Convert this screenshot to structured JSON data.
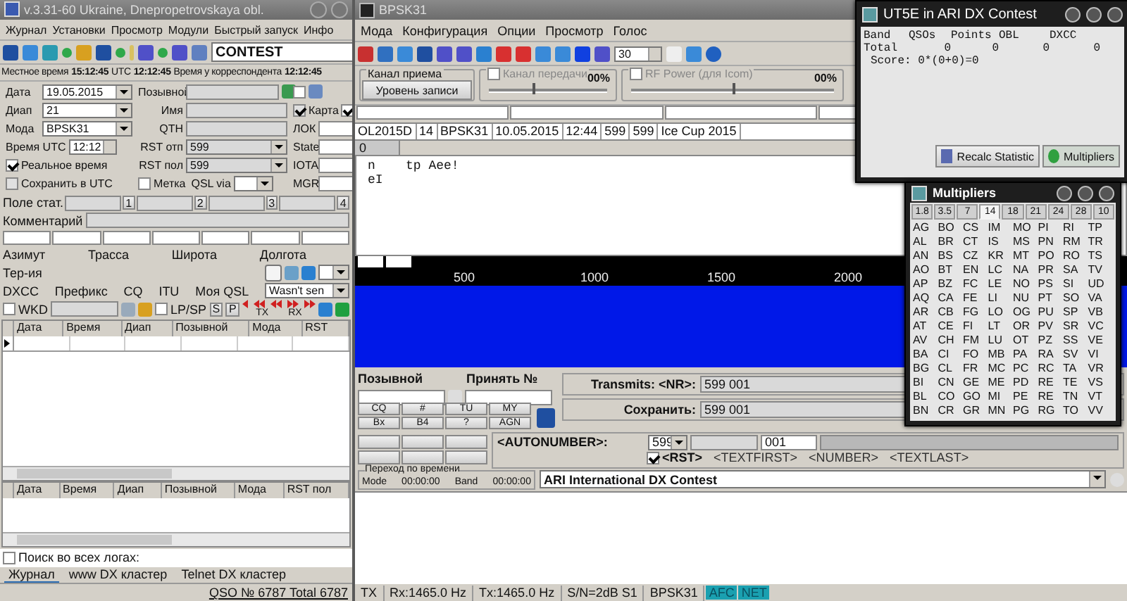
{
  "left": {
    "title": "v.3.31-60 Ukraine, Dnepropetrovskaya obl.",
    "menu": [
      "Журнал",
      "Установки",
      "Просмотр",
      "Модули",
      "Быстрый запуск",
      "Инфо"
    ],
    "mode_select": "CONTEST",
    "clock": [
      {
        "label": "Местное время",
        "value": "15:12:45"
      },
      {
        "label": "UTC",
        "value": "12:12:45"
      },
      {
        "label": "Время у корреспондента",
        "value": "12:12:45"
      }
    ],
    "date": {
      "label": "Дата",
      "value": "19.05.2015"
    },
    "band": {
      "label": "Диап",
      "value": "21"
    },
    "mode": {
      "label": "Мода",
      "value": "BPSK31"
    },
    "utc_time": {
      "label": "Время UTC",
      "value": "12:12"
    },
    "realtime": {
      "label": "Реальное время",
      "checked": true
    },
    "save_utc": {
      "label": "Сохранить в UTC",
      "checked": false
    },
    "callsign_label": "Позывной",
    "name_label": "Имя",
    "qth_label": "QTH",
    "rst_sent": {
      "label": "RST отп",
      "value": "599"
    },
    "rst_rcvd": {
      "label": "RST пол",
      "value": "599"
    },
    "mark": {
      "label": "Метка",
      "checked": false
    },
    "qsl_via_label": "QSL via",
    "map": {
      "label": "Карта",
      "checked": true
    },
    "side_checks": [
      {
        "checked": false
      },
      {
        "checked": true
      }
    ],
    "side_fields": [
      "ЛОК",
      "State",
      "IOTA",
      "MGR"
    ],
    "stat_label": "Поле стат.",
    "stat_buttons": [
      "1",
      "2",
      "3",
      "4"
    ],
    "comment_label": "Комментарий",
    "info_row1": [
      "Азимут",
      "Трасса",
      "Широта",
      "Долгота"
    ],
    "territory_label": "Тер-ия",
    "info_row3": [
      "DXCC",
      "Префикс",
      "CQ",
      "ITU",
      "Моя QSL"
    ],
    "my_qsl": "Wasn't sen",
    "wkd": {
      "label": "WKD",
      "checked": false
    },
    "lpsp": {
      "label": "LP/SP",
      "checked": false
    },
    "sp_buttons": [
      "S",
      "P"
    ],
    "txrx": [
      "TX",
      "RX"
    ],
    "log_columns": [
      "Дата",
      "Время",
      "Диап",
      "Позывной",
      "Мода",
      "RST"
    ],
    "dup_columns": [
      "Дата",
      "Время",
      "Диап",
      "Позывной",
      "Мода",
      "RST пол"
    ],
    "search_all": {
      "label": "Поиск во всех логах:",
      "checked": false
    },
    "tabs": [
      {
        "label": "Журнал",
        "selected": true
      },
      {
        "label": "www DX кластер",
        "selected": false
      },
      {
        "label": "Telnet DX кластер",
        "selected": false
      }
    ],
    "status": "QSO № 6787 Total 6787"
  },
  "main": {
    "title": "BPSK31",
    "menu": [
      "Мода",
      "Конфигурация",
      "Опции",
      "Просмотр",
      "Голос"
    ],
    "spin_value": "30",
    "rx_channel": {
      "title": "Канал приема",
      "button": "Уровень записи"
    },
    "tx_channel": {
      "label": "Канал передачи",
      "checked": false,
      "reading": "00%",
      "level": 0.37
    },
    "rf_power": {
      "label": "RF Power (для Icom)",
      "checked": false,
      "reading": "00%",
      "level": 0.5
    },
    "info_strip": [
      "OL2015D",
      "14",
      "BPSK31",
      "10.05.2015",
      "12:44",
      "599",
      "599",
      "Ice Cup 2015"
    ],
    "rx_tab": "0",
    "rx_text": [
      "n    tp Aee!",
      "eI"
    ],
    "scale": [
      "500",
      "1000",
      "1500",
      "2000"
    ],
    "callsign_label": "Позывной",
    "receive_label": "Принять №",
    "macros": [
      "CQ",
      "#",
      "TU",
      "MY",
      "Bx",
      "B4",
      "?",
      "AGN"
    ],
    "transmit": {
      "label": "Transmits: <NR>:",
      "value": "599 001"
    },
    "save": {
      "label": "Сохранить:",
      "value": "599 001"
    },
    "autonumber": {
      "label": "<AUTONUMBER>:",
      "rst": "599",
      "number": "001",
      "rst_check": {
        "label": "<RST>",
        "checked": true
      },
      "tags": [
        "<TEXTFIRST>",
        "<NUMBER>",
        "<TEXTLAST>"
      ]
    },
    "time_jump": {
      "title": "Переход по времени",
      "items": [
        "Mode",
        "00:00:00",
        "Band",
        "00:00:00"
      ]
    },
    "contest": "ARI International DX Contest",
    "status": [
      "TX",
      "Rx:1465.0 Hz",
      "Tx:1465.0 Hz",
      "S/N=2dB S1",
      "BPSK31"
    ],
    "flags": [
      {
        "label": "AFC",
        "on": true
      },
      {
        "label": "NET",
        "on": true
      }
    ]
  },
  "stats": {
    "title": "UT5E in ARI DX Contest",
    "columns": [
      "Band",
      "QSOs",
      "Points",
      "OBL",
      "DXCC"
    ],
    "rows": [
      [
        "Total",
        "0",
        "0",
        "0",
        "0"
      ]
    ],
    "score": "Score: 0*(0+0)=0",
    "buttons": [
      "Recalc Statistic",
      "Multipliers"
    ]
  },
  "multipliers": {
    "title": "Multipliers",
    "bands": [
      {
        "label": "1.8",
        "selected": false
      },
      {
        "label": "3.5",
        "selected": false
      },
      {
        "label": "7",
        "selected": false
      },
      {
        "label": "14",
        "selected": true
      },
      {
        "label": "18",
        "selected": false
      },
      {
        "label": "21",
        "selected": false
      },
      {
        "label": "24",
        "selected": false
      },
      {
        "label": "28",
        "selected": false
      },
      {
        "label": "10",
        "selected": false
      }
    ],
    "rows": [
      [
        "AG",
        "BO",
        "CS",
        "IM",
        "MO",
        "PI",
        "RI",
        "TP"
      ],
      [
        "AL",
        "BR",
        "CT",
        "IS",
        "MS",
        "PN",
        "RM",
        "TR"
      ],
      [
        "AN",
        "BS",
        "CZ",
        "KR",
        "MT",
        "PO",
        "RO",
        "TS"
      ],
      [
        "AO",
        "BT",
        "EN",
        "LC",
        "NA",
        "PR",
        "SA",
        "TV"
      ],
      [
        "AP",
        "BZ",
        "FC",
        "LE",
        "NO",
        "PS",
        "SI",
        "UD"
      ],
      [
        "AQ",
        "CA",
        "FE",
        "LI",
        "NU",
        "PT",
        "SO",
        "VA"
      ],
      [
        "AR",
        "CB",
        "FG",
        "LO",
        "OG",
        "PU",
        "SP",
        "VB"
      ],
      [
        "AT",
        "CE",
        "FI",
        "LT",
        "OR",
        "PV",
        "SR",
        "VC"
      ],
      [
        "AV",
        "CH",
        "FM",
        "LU",
        "OT",
        "PZ",
        "SS",
        "VE"
      ],
      [
        "BA",
        "CI",
        "FO",
        "MB",
        "PA",
        "RA",
        "SV",
        "VI"
      ],
      [
        "BG",
        "CL",
        "FR",
        "MC",
        "PC",
        "RC",
        "TA",
        "VR"
      ],
      [
        "BI",
        "CN",
        "GE",
        "ME",
        "PD",
        "RE",
        "TE",
        "VS"
      ],
      [
        "BL",
        "CO",
        "GO",
        "MI",
        "PE",
        "RE",
        "TN",
        "VT"
      ],
      [
        "BN",
        "CR",
        "GR",
        "MN",
        "PG",
        "RG",
        "TO",
        "VV"
      ]
    ]
  }
}
